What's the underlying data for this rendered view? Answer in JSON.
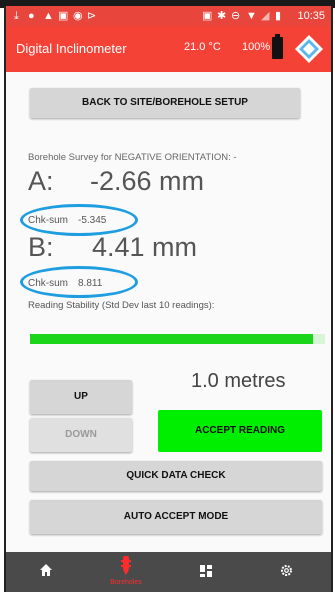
{
  "status_bar": {
    "time": "10:35",
    "left_icons": [
      "download-icon",
      "location-icon",
      "warning-icon",
      "image-icon",
      "record-icon",
      "shortcut-icon"
    ],
    "right_icons": [
      "nfc-icon",
      "bluetooth-icon",
      "minus-circle-icon",
      "wifi-icon",
      "no-signal-icon",
      "battery-icon"
    ]
  },
  "app_bar": {
    "title": "Digital Inclinometer",
    "temperature": "21.0 °C",
    "battery": "100%"
  },
  "actions": {
    "back_label": "BACK TO SITE/BOREHOLE SETUP",
    "up_label": "UP",
    "down_label": "DOWN",
    "accept_label": "ACCEPT READING",
    "quick_check_label": "QUICK DATA CHECK",
    "auto_accept_label": "AUTO ACCEPT MODE"
  },
  "survey": {
    "heading": "Borehole Survey for NEGATIVE ORIENTATION: -",
    "a_label": "A:",
    "a_value": "-2.66 mm",
    "a_chk_label": "Chk-sum",
    "a_chk_value": "-5.345",
    "b_label": "B:",
    "b_value": "4.41 mm",
    "b_chk_label": "Chk-sum",
    "b_chk_value": "8.811"
  },
  "stability": {
    "label": "Reading Stability (Std Dev last 10 readings):",
    "level": 0.96
  },
  "depth": "1.0 metres",
  "colors": {
    "header": "#f44336",
    "accept": "#00ee00",
    "stability_bar": "#1bd51b",
    "highlight_circle": "#1e9ee0",
    "nav_bg": "#4a4a4a",
    "nav_active": "#ff2b2b"
  },
  "bottom_nav": {
    "items": [
      {
        "icon": "home-icon",
        "label": ""
      },
      {
        "icon": "borehole-icon",
        "label": "Boreholes"
      },
      {
        "icon": "dashboard-icon",
        "label": ""
      },
      {
        "icon": "settings-icon",
        "label": ""
      }
    ]
  }
}
